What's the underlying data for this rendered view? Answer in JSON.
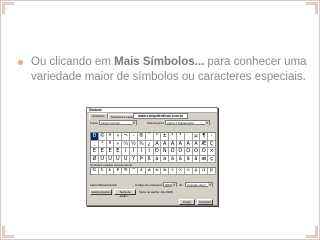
{
  "slide": {
    "text_before": "Ou clicando em ",
    "text_bold": "Mais Símbolos...",
    "text_after": " para conhecer uma variedade maior de símbolos ou caracteres especiais."
  },
  "dialog": {
    "title": "Símbolo",
    "tabs": [
      "Símbolos",
      "Caracteres especiais"
    ],
    "url_text": "www.computerdicas.com.br",
    "font_label": "Fonte:",
    "font_value": "(texto normal)",
    "subset_label": "Subconjunto:",
    "subset_value": "Latim-1 Suplemento",
    "symbols": [
      "Ð",
      "©",
      "ª",
      "«",
      "¬",
      "-",
      "®",
      "¯",
      "°",
      "±",
      "²",
      "³",
      "´",
      "µ",
      "¶",
      "·",
      "¸",
      "¹",
      "º",
      "»",
      "¼",
      "½",
      "¾",
      "¿",
      "À",
      "Á",
      "Â",
      "Ã",
      "Ä",
      "Å",
      "Æ",
      "Ç",
      "È",
      "É",
      "Ê",
      "Ë",
      "Ì",
      "Í",
      "Î",
      "Ï",
      "Ð",
      "Ñ",
      "Ò",
      "Ó",
      "Ô",
      "Õ",
      "Ö",
      "×",
      "Ø",
      "Ù",
      "Ú",
      "Û",
      "Ü",
      "Ý",
      "Þ",
      "ß",
      "à",
      "á",
      "â",
      "ã",
      "ä",
      "å",
      "æ",
      "ç"
    ],
    "selected_index": 0,
    "recent_label": "Símbolos usados recentemente:",
    "recent": [
      "©",
      "€",
      "£",
      "¥",
      "®",
      "™",
      "±",
      "≠",
      "≤",
      "≥",
      "÷",
      "×",
      "∞",
      "µ",
      "α",
      "β"
    ],
    "char_name_label": "Latim Maiúscula Eth",
    "char_code_label": "Código do caractere:",
    "char_code_value": "00D0",
    "from_label": "de:",
    "from_value": "Unicode (hex)",
    "autocorrect_label": "AutoCorreção...",
    "shortcut_key_label": "Tecla de atalho...",
    "shortcut_text": "Tecla de atalho: Alt+0208",
    "insert_label": "Inserir",
    "cancel_label": "Cancelar"
  }
}
